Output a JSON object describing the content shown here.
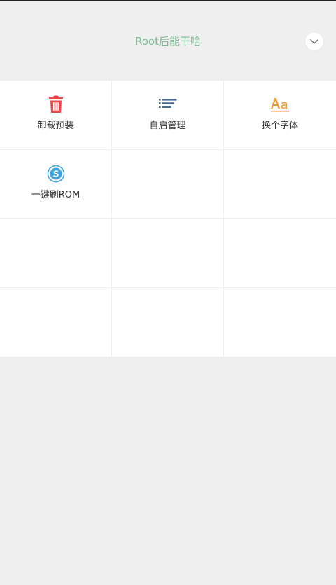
{
  "header": {
    "title": "Root后能干啥"
  },
  "tools": [
    {
      "label": "卸载预装",
      "icon": "trash-icon",
      "color": "#e8474a"
    },
    {
      "label": "自启管理",
      "icon": "list-icon",
      "color": "#4d6a8f"
    },
    {
      "label": "换个字体",
      "icon": "font-icon",
      "color": "#ef9a2e"
    },
    {
      "label": "一键刷ROM",
      "icon": "rom-flash-icon",
      "color": "#3ba3e0"
    }
  ],
  "colors": {
    "title": "#7cb892",
    "background": "#efefef",
    "grid": "#ffffff",
    "label": "#333333"
  }
}
